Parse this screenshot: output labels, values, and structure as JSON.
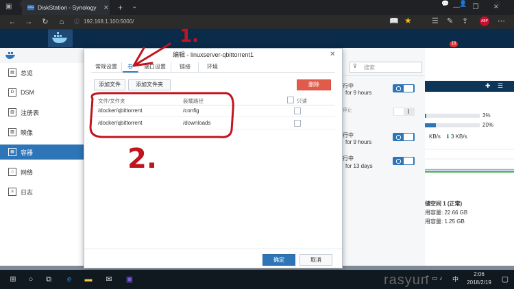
{
  "browser": {
    "tab_title": "DiskStation - Synology",
    "tab_fav_text": "DSM",
    "url": "192.168.1.100:5000/"
  },
  "dsm": {
    "notify_count": "18"
  },
  "sidebar": {
    "items": [
      {
        "label": "总览",
        "icon": "overview-icon"
      },
      {
        "label": "DSM",
        "icon": "dsm-icon"
      },
      {
        "label": "注册表",
        "icon": "registry-icon"
      },
      {
        "label": "映像",
        "icon": "image-icon"
      },
      {
        "label": "容器",
        "icon": "container-icon",
        "selected": true
      },
      {
        "label": "网络",
        "icon": "network-icon"
      },
      {
        "label": "日志",
        "icon": "log-icon"
      }
    ]
  },
  "right_panel": {
    "search_placeholder": "搜索",
    "containers": [
      {
        "status": "行中",
        "uptime": "for 9 hours",
        "on": true
      },
      {
        "status": "停止",
        "uptime": "",
        "on": false
      },
      {
        "status": "行中",
        "uptime": "for 9 hours",
        "on": true
      },
      {
        "status": "行中",
        "uptime": "for 13 days",
        "on": true
      }
    ]
  },
  "resource": {
    "cpu": "3%",
    "ram": "20%",
    "up": "KB/s",
    "down": "3 KB/s",
    "cpu_fraction": 0.03,
    "ram_fraction": 0.2,
    "volume_title": "储空间 1 (正常)",
    "used": "用容量: 22.66 GB",
    "free": "用容量: 1.25 GB"
  },
  "dialog": {
    "title": "编辑 - linuxserver-qbittorrent1",
    "tabs": [
      "常规设置",
      "卷",
      "端口设置",
      "链接",
      "环境"
    ],
    "active_tab": 1,
    "add_file": "添加文件",
    "add_folder": "添加文件夹",
    "delete": "删除",
    "columns": [
      "文件/文件夹",
      "装载路径",
      "只读"
    ],
    "rows": [
      {
        "path": "/docker/qbittorrent",
        "mount": "/config",
        "readonly": false
      },
      {
        "path": "/docker/qbittorrent",
        "mount": "/downloads",
        "readonly": false
      }
    ],
    "ok": "确定",
    "cancel": "取消"
  },
  "annotations": {
    "one": "1.",
    "two": "2."
  },
  "taskbar": {
    "time": "2:06",
    "date": "2018/2/19",
    "watermark": "rasyun",
    "lang": "中"
  }
}
